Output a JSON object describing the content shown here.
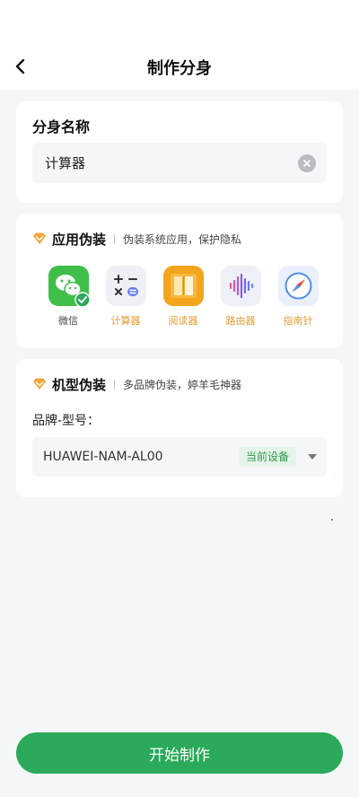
{
  "header": {
    "title": "制作分身",
    "back_icon": "chevron-left-icon"
  },
  "name_card": {
    "label": "分身名称",
    "input_value": "计算器",
    "clear_icon": "clear-icon"
  },
  "app_disguise": {
    "title": "应用伪装",
    "subtitle": "伪装系统应用，保护隐私",
    "apps": [
      {
        "name": "微信",
        "icon": "wechat-icon",
        "selected": true
      },
      {
        "name": "计算器",
        "icon": "calculator-icon",
        "selected": false
      },
      {
        "name": "阅读器",
        "icon": "book-icon",
        "selected": false
      },
      {
        "name": "路由器",
        "icon": "soundwave-icon",
        "selected": false
      },
      {
        "name": "指南针",
        "icon": "compass-icon",
        "selected": false
      }
    ]
  },
  "model_disguise": {
    "title": "机型伪装",
    "subtitle": "多品牌伪装，婷羊毛神器",
    "field_label": "品牌-型号：",
    "selected_model": "HUAWEI-NAM-AL00",
    "badge": "当前设备"
  },
  "footer": {
    "start_button": "开始制作"
  },
  "colors": {
    "accent_green": "#2aaa5a",
    "accent_orange": "#e29b34",
    "background": "#f5f6f8"
  }
}
